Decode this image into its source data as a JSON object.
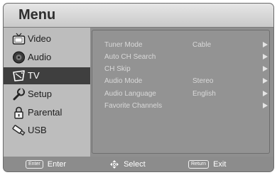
{
  "menu": {
    "title": "Menu"
  },
  "sidebar": {
    "items": [
      {
        "label": "Video",
        "icon": "video-icon",
        "selected": false
      },
      {
        "label": "Audio",
        "icon": "audio-icon",
        "selected": false
      },
      {
        "label": "TV",
        "icon": "tv-icon",
        "selected": true
      },
      {
        "label": "Setup",
        "icon": "setup-icon",
        "selected": false
      },
      {
        "label": "Parental",
        "icon": "lock-icon",
        "selected": false
      },
      {
        "label": "USB",
        "icon": "usb-icon",
        "selected": false
      }
    ]
  },
  "settings": [
    {
      "label": "Tuner Mode",
      "value": "Cable"
    },
    {
      "label": "Auto CH Search",
      "value": ""
    },
    {
      "label": "CH Skip",
      "value": ""
    },
    {
      "label": "Audio Mode",
      "value": "Stereo"
    },
    {
      "label": "Audio Language",
      "value": "English"
    },
    {
      "label": "Favorite Channels",
      "value": ""
    }
  ],
  "footer": {
    "enter_key": "Enter",
    "enter_label": "Enter",
    "select_label": "Select",
    "return_key": "Return",
    "exit_label": "Exit"
  },
  "colors": {
    "selected_bg": "#3f3f3f",
    "sidebar_bg": "#bdbdbd",
    "content_bg": "#939393",
    "title_bg": "#dcdcdc"
  }
}
